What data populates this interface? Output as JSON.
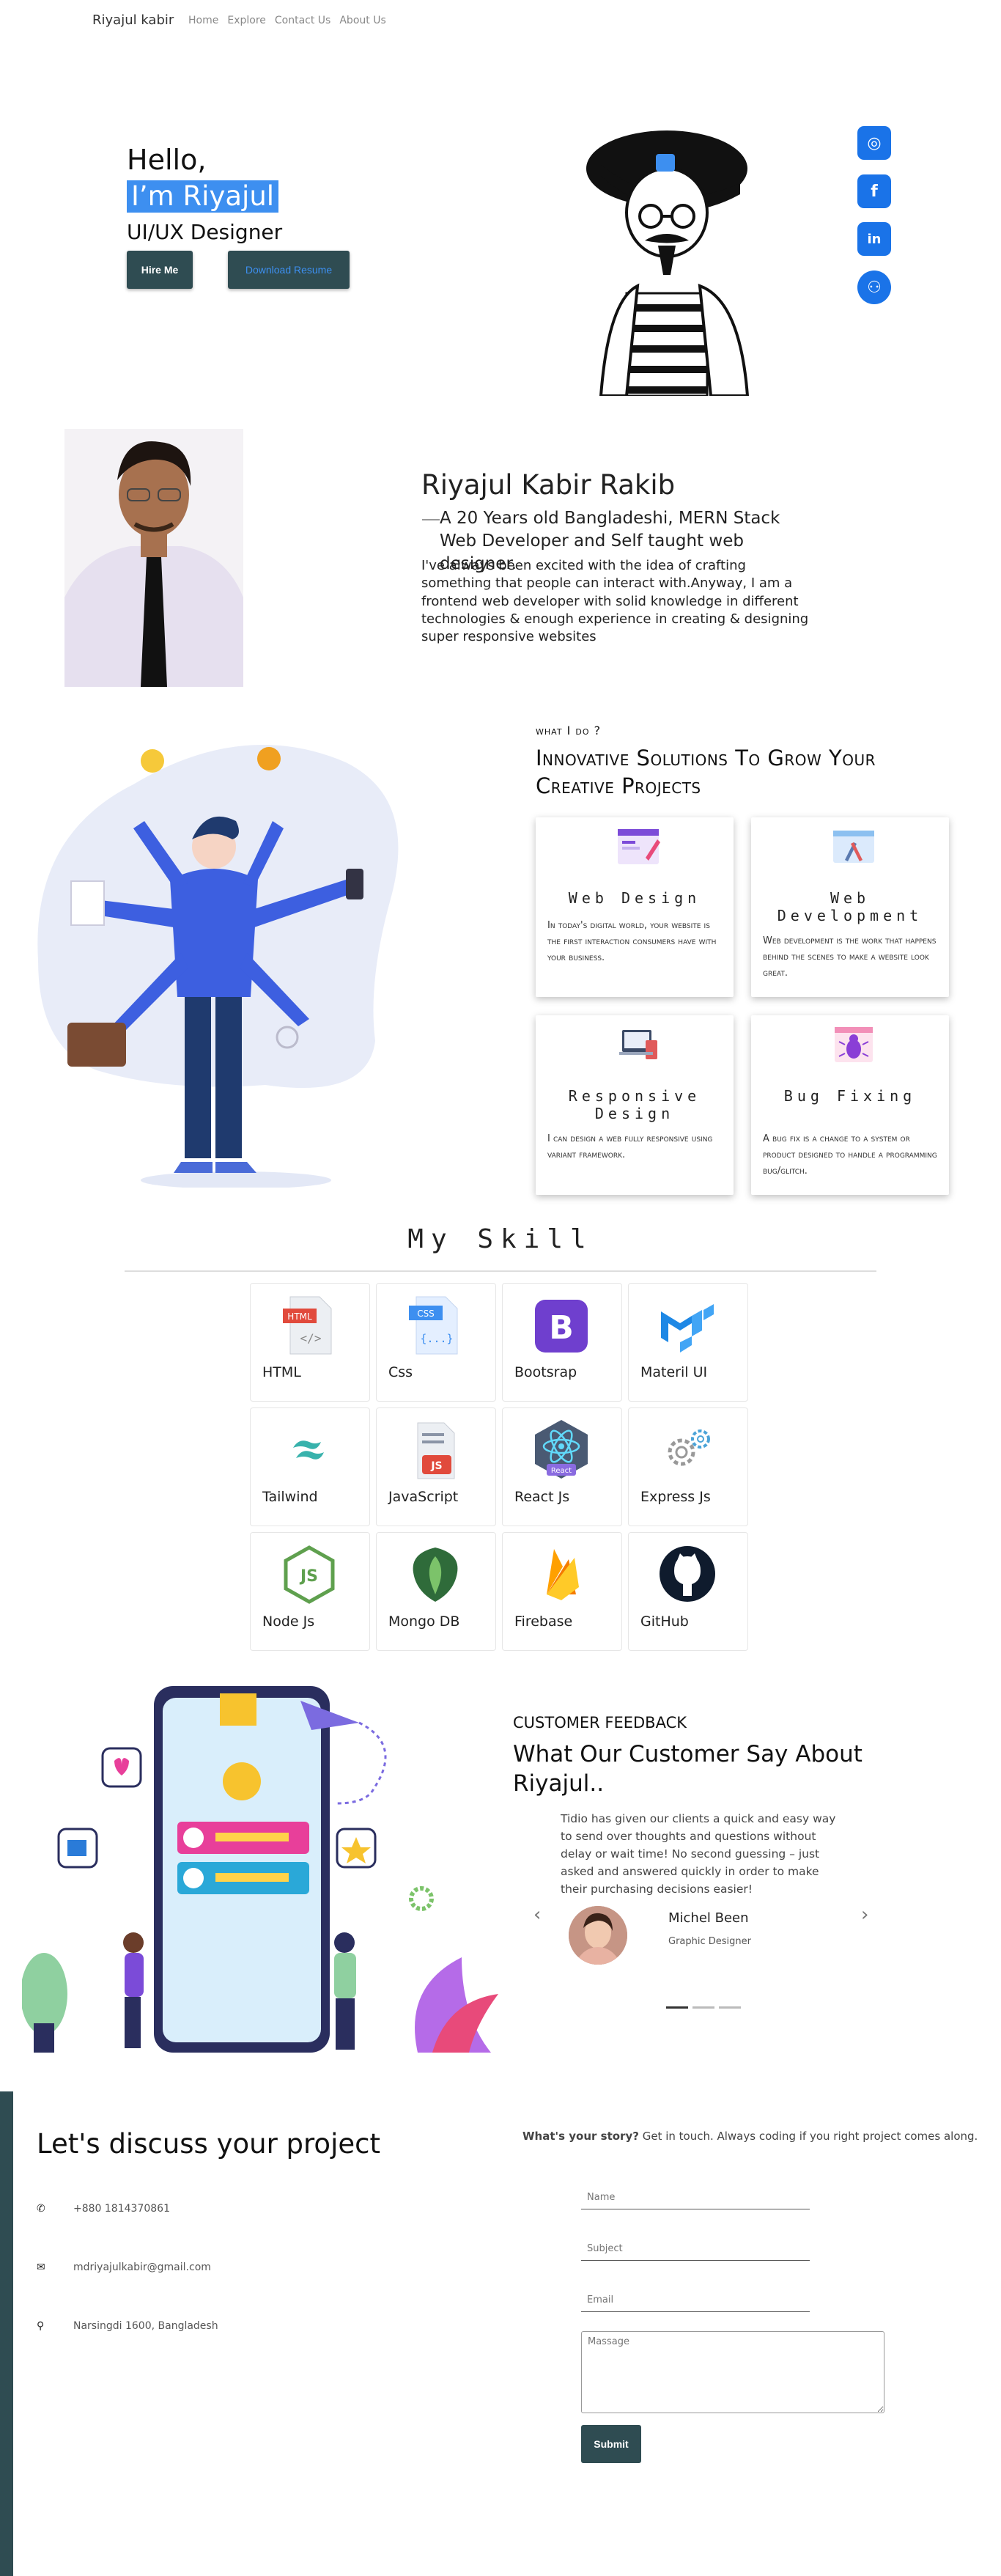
{
  "nav": {
    "brand": "Riyajul kabir",
    "links": [
      "Home",
      "Explore",
      "Contact Us",
      "About Us"
    ]
  },
  "hero": {
    "greeting": "Hello,",
    "name": "I’m Riyajul",
    "role": "UI/UX Designer",
    "hire_label": "Hire Me",
    "download_label": "Download Resume",
    "social": [
      {
        "name": "instagram-icon",
        "glyph": "◎"
      },
      {
        "name": "facebook-icon",
        "glyph": "f"
      },
      {
        "name": "linkedin-icon",
        "glyph": "in"
      },
      {
        "name": "github-icon",
        "glyph": "⚇"
      }
    ]
  },
  "about": {
    "title": "Riyajul Kabir Rakib",
    "subtitle": "A 20 Years old Bangladeshi, MERN Stack Web Developer and Self taught web designer.",
    "body": "I've always been excited with the idea of crafting something that people can interact with.Anyway, I am a frontend web developer with solid knowledge in different technologies & enough experience in creating & designing super responsive websites"
  },
  "services": {
    "kicker": "what I do ?",
    "title": "Innovative Solutions To Grow Your Creative Projects",
    "cards": [
      {
        "title": "Web Design",
        "desc": "In today's digital world, your website is the first interaction consumers have with your business."
      },
      {
        "title": "Web Development",
        "desc": "Web development is the work that happens behind the scenes to make a website look great."
      },
      {
        "title": "Responsive Design",
        "desc": "I can design a web fully responsive using variant framework."
      },
      {
        "title": "Bug Fixing",
        "desc": "A bug fix is a change to a system or product designed to handle a programming bug/glitch."
      }
    ]
  },
  "skills": {
    "title": "My Skill",
    "items": [
      {
        "label": "HTML",
        "icon": "html-icon",
        "badge": "HTML"
      },
      {
        "label": "Css",
        "icon": "css-icon",
        "badge": "CSS"
      },
      {
        "label": "Bootsrap",
        "icon": "bootstrap-icon",
        "badge": "B"
      },
      {
        "label": "Materil UI",
        "icon": "material-ui-icon",
        "badge": "M"
      },
      {
        "label": "Tailwind",
        "icon": "tailwind-icon",
        "badge": "~"
      },
      {
        "label": "JavaScript",
        "icon": "javascript-icon",
        "badge": "JS"
      },
      {
        "label": "React Js",
        "icon": "react-icon",
        "badge": "React"
      },
      {
        "label": "Express Js",
        "icon": "express-icon",
        "badge": "⚙"
      },
      {
        "label": "Node Js",
        "icon": "nodejs-icon",
        "badge": "JS"
      },
      {
        "label": "Mongo DB",
        "icon": "mongodb-icon",
        "badge": ""
      },
      {
        "label": "Firebase",
        "icon": "firebase-icon",
        "badge": ""
      },
      {
        "label": "GitHub",
        "icon": "github-icon",
        "badge": ""
      }
    ]
  },
  "feedback": {
    "kicker": "CUSTOMER FEEDBACK",
    "title": "What Our Customer Say About Riyajul..",
    "quote": "Tidio has given our clients a quick and easy way to send over thoughts and questions without delay or wait time! No second guessing – just asked and answered quickly in order to make their purchasing decisions easier!",
    "name": "Michel Been",
    "role": "Graphic Designer",
    "prev": "‹",
    "next": "›"
  },
  "contact": {
    "title": "Let's discuss your project",
    "phone": "+880 1814370861",
    "email": "mdriyajulkabir@gmail.com",
    "address": "Narsingdi 1600, Bangladesh",
    "story_bold": "What's your story?",
    "story_rest": " Get in touch. Always coding if you right project comes along.",
    "name_placeholder": "Name",
    "subject_placeholder": "Subject",
    "email_placeholder": "Email",
    "message_placeholder": "Massage",
    "submit_label": "Submit"
  },
  "colors": {
    "accent": "#3d8ff0",
    "dark_teal": "#2f4c52",
    "social_blue": "#1a73e8"
  }
}
